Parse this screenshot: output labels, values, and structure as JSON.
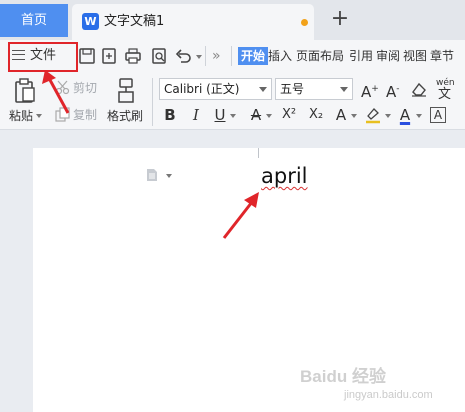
{
  "tabs": {
    "home_label": "首页",
    "doc_logo": "W",
    "doc_title": "文字文稿1",
    "new_tab": "+"
  },
  "quickbar": {
    "file_label": "文件",
    "more": "»",
    "ribbon_tabs": [
      "开始",
      "插入",
      "页面布局",
      "引用",
      "审阅",
      "视图",
      "章节"
    ]
  },
  "ribbon": {
    "paste": "粘贴",
    "cut": "剪切",
    "copy": "复制",
    "format_painter": "格式刷",
    "font_name": "Calibri (正文)",
    "font_size": "五号",
    "pinyin": "wén",
    "format_buttons": {
      "bold": "B",
      "italic": "I",
      "underline": "U",
      "strike": "A",
      "superscript": "X²",
      "subscript": "X₂",
      "effect": "A",
      "font_color": "A",
      "char_border": "A"
    }
  },
  "document": {
    "text": "april"
  },
  "watermark": {
    "text": "Baidu 经验",
    "sub": "jingyan.baidu.com"
  },
  "colors": {
    "accent": "#4f8ff0",
    "annotation_red": "#e0252a",
    "modified_dot": "#f2a21a"
  }
}
